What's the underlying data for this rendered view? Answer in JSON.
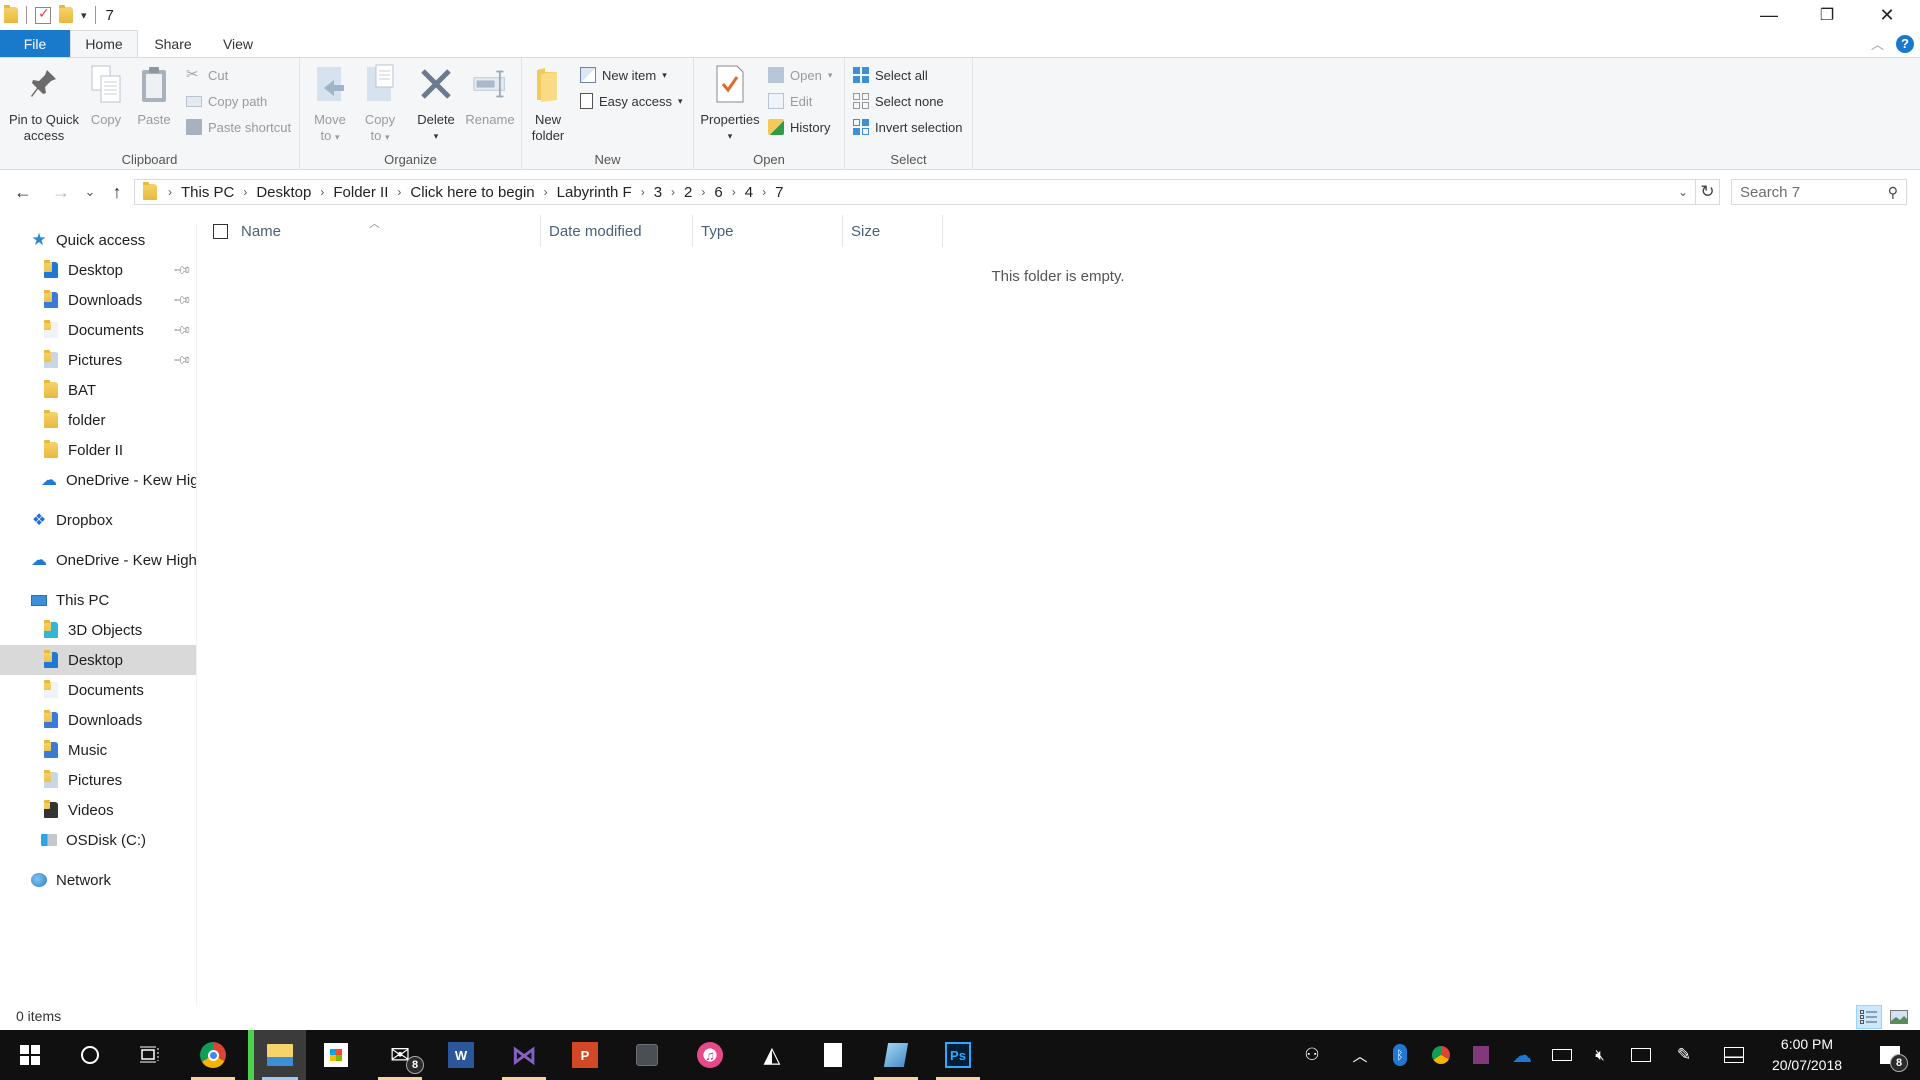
{
  "window": {
    "title": "7",
    "minimize_label": "—",
    "maximize_label": "❐",
    "close_label": "✕"
  },
  "ribbon_tabs": [
    {
      "label": "File"
    },
    {
      "label": "Home"
    },
    {
      "label": "Share"
    },
    {
      "label": "View"
    }
  ],
  "ribbon": {
    "clipboard": {
      "label": "Clipboard",
      "pin": "Pin to Quick access",
      "pin_l1": "Pin to Quick",
      "pin_l2": "access",
      "copy": "Copy",
      "paste": "Paste",
      "cut": "Cut",
      "copy_path": "Copy path",
      "paste_shortcut": "Paste shortcut"
    },
    "organize": {
      "label": "Organize",
      "move_l1": "Move",
      "move_l2": "to",
      "copy_l1": "Copy",
      "copy_l2": "to",
      "delete": "Delete",
      "rename": "Rename"
    },
    "new": {
      "label": "New",
      "new_folder_l1": "New",
      "new_folder_l2": "folder",
      "new_item": "New item",
      "easy_access": "Easy access"
    },
    "open": {
      "label": "Open",
      "properties": "Properties",
      "open": "Open",
      "edit": "Edit",
      "history": "History"
    },
    "select": {
      "label": "Select",
      "select_all": "Select all",
      "select_none": "Select none",
      "invert_selection": "Invert selection"
    }
  },
  "navigation": {
    "back": "←",
    "forward": "→",
    "recent": "⌄",
    "up": "↑",
    "breadcrumbs": [
      "This PC",
      "Desktop",
      "Folder II",
      "Click here to begin",
      "Labyrinth F",
      "3",
      "2",
      "6",
      "4",
      "7"
    ],
    "search_placeholder": "Search 7"
  },
  "sidebar": {
    "quick_access": "Quick access",
    "quick_items": [
      {
        "label": "Desktop",
        "pinned": true
      },
      {
        "label": "Downloads",
        "pinned": true
      },
      {
        "label": "Documents",
        "pinned": true
      },
      {
        "label": "Pictures",
        "pinned": true
      },
      {
        "label": "BAT",
        "pinned": false
      },
      {
        "label": "folder",
        "pinned": false
      },
      {
        "label": "Folder II",
        "pinned": false
      },
      {
        "label": "OneDrive - Kew High School",
        "pinned": false
      }
    ],
    "dropbox": "Dropbox",
    "onedrive": "OneDrive - Kew High School",
    "this_pc": "This PC",
    "pc_items": [
      {
        "label": "3D Objects"
      },
      {
        "label": "Desktop",
        "selected": true
      },
      {
        "label": "Documents"
      },
      {
        "label": "Downloads"
      },
      {
        "label": "Music"
      },
      {
        "label": "Pictures"
      },
      {
        "label": "Videos"
      },
      {
        "label": "OSDisk (C:)"
      }
    ],
    "network": "Network"
  },
  "content": {
    "columns": [
      "Name",
      "Date modified",
      "Type",
      "Size"
    ],
    "empty_message": "This folder is empty."
  },
  "status": {
    "items_count": "0 items"
  },
  "taskbar": {
    "apps": [
      "Start",
      "Cortana",
      "Task View",
      "Google Chrome",
      "File Explorer",
      "Microsoft Store",
      "Mail",
      "Word",
      "Visual Studio",
      "PowerPoint",
      "App",
      "iTunes",
      "Unity",
      "File",
      "Notepad",
      "Photoshop"
    ],
    "mail_badge": "8",
    "time": "6:00 PM",
    "date": "20/07/2018",
    "notification_badge": "8"
  }
}
